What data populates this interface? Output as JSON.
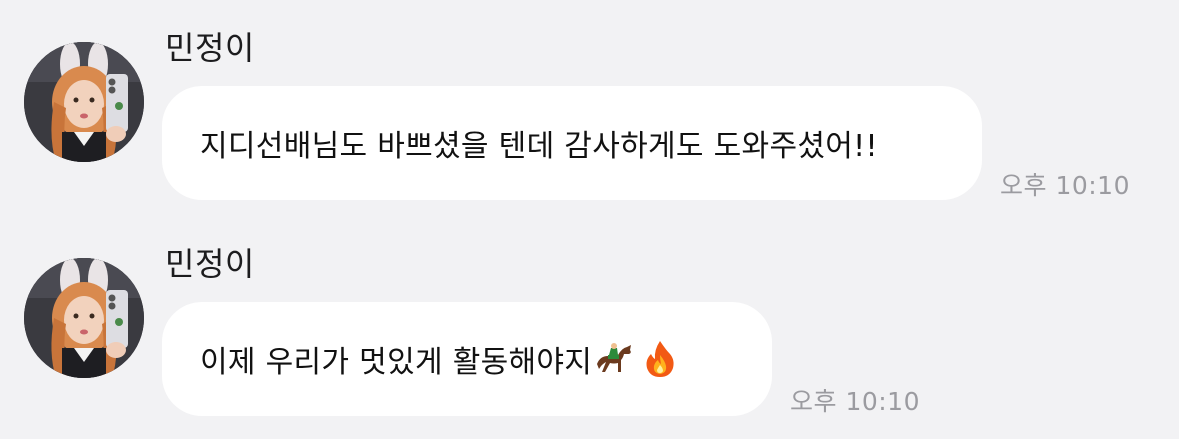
{
  "messages": [
    {
      "sender": "민정이",
      "text": "지디선배님도 바쁘셨을 텐데 감사하게도 도와주셨어!!",
      "time": "오후 10:10"
    },
    {
      "sender": "민정이",
      "text": "이제 우리가 멋있게 활동해야지",
      "emojis": [
        "🏇",
        "🔥"
      ],
      "emoji_icons": [
        "horse-racing-icon",
        "fire-icon"
      ],
      "time": "오후 10:10"
    }
  ]
}
